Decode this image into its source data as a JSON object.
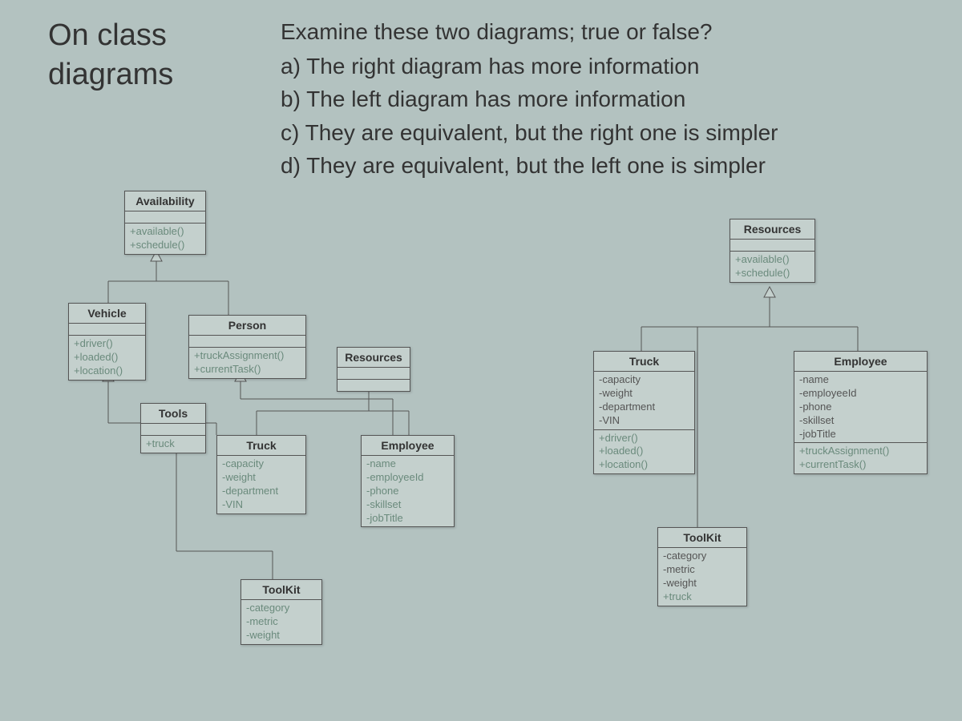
{
  "title_line1": "On class",
  "title_line2": "diagrams",
  "question": {
    "prompt": "Examine these two diagrams; true or false?",
    "a": "a)  The right diagram has more information",
    "b": "b)  The left diagram has more information",
    "c": "c)  They are equivalent, but the right one is simpler",
    "d": "d)  They are equivalent, but the left one is simpler"
  },
  "left": {
    "availability": {
      "name": "Availability",
      "ops": [
        "+available()",
        "+schedule()"
      ]
    },
    "vehicle": {
      "name": "Vehicle",
      "ops": [
        "+driver()",
        "+loaded()",
        "+location()"
      ]
    },
    "person": {
      "name": "Person",
      "ops": [
        "+truckAssignment()",
        "+currentTask()"
      ]
    },
    "resources": {
      "name": "Resources"
    },
    "tools": {
      "name": "Tools",
      "attrs": [
        "+truck"
      ]
    },
    "truck": {
      "name": "Truck",
      "attrs": [
        "-capacity",
        "-weight",
        "-department",
        "-VIN"
      ]
    },
    "employee": {
      "name": "Employee",
      "attrs": [
        "-name",
        "-employeeId",
        "-phone",
        "-skillset",
        "-jobTitle"
      ]
    },
    "toolkit": {
      "name": "ToolKit",
      "attrs": [
        "-category",
        "-metric",
        "-weight"
      ]
    }
  },
  "right": {
    "resources": {
      "name": "Resources",
      "ops": [
        "+available()",
        "+schedule()"
      ]
    },
    "truck": {
      "name": "Truck",
      "attrs": [
        "-capacity",
        "-weight",
        "-department",
        "-VIN"
      ],
      "ops": [
        "+driver()",
        "+loaded()",
        "+location()"
      ]
    },
    "employee": {
      "name": "Employee",
      "attrs": [
        "-name",
        "-employeeId",
        "-phone",
        "-skillset",
        "-jobTitle"
      ],
      "ops": [
        "+truckAssignment()",
        "+currentTask()"
      ]
    },
    "toolkit": {
      "name": "ToolKit",
      "attrs": [
        "-category",
        "-metric",
        "-weight",
        "+truck"
      ]
    }
  }
}
